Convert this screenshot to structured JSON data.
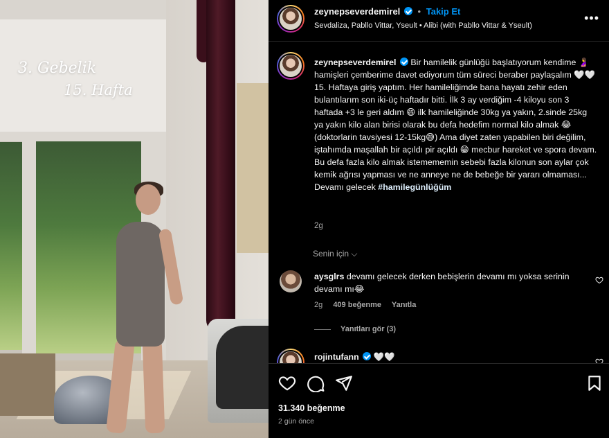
{
  "photo": {
    "overlay_line1": "3. Gebelik",
    "overlay_line2": "15. Hafta"
  },
  "header": {
    "username": "zeynepseverdemirel",
    "separator": "•",
    "follow_label": "Takip Et",
    "audio": "Sevdaliza, Pabllo Vittar, Yseult • Alibi (with Pabllo Vittar & Yseult)",
    "more_icon": "more-horizontal-icon"
  },
  "caption": {
    "username": "zeynepseverdemirel",
    "text": "Bir hamilelik günlüğü başlatıyorum kendime 🤰 hamişleri çemberime davet ediyorum tüm süreci beraber paylaşalım 🤍🤍 15. Haftaya giriş yaptım. Her hamileliğimde bana hayatı zehir eden bulantılarım son iki-üç haftadır bitti. İlk 3 ay verdiğim -4 kiloyu son 3 haftada +3 le geri aldım 😄 ilk hamileliğinde 30kg ya yakın, 2.sinde 25kg ya yakın kilo alan birisi olarak bu defa hedefim normal kilo almak 😂 (doktorlarin tavsiyesi 12-15kg😅) Ama diyet zaten yapabilen biri değilim, iştahımda maşallah bir açıldı pir açıldı 😁 mecbur hareket ve spora devam. Bu defa fazla kilo almak istemememin sebebi fazla kilonun son aylar çok kemik ağrısı yapması ve ne anneye ne de bebeğe bir yararı olmaması... Devamı gelecek",
    "hashtag": "#hamilegünlüğüm",
    "time": "2g"
  },
  "filter_label": "Senin için ⌵",
  "comments": [
    {
      "username": "aysglrs",
      "text": "devamı gelecek derken bebişlerin devamı mı yoksa serinin devamı mı😂",
      "time": "2g",
      "likes": "409 beğenme",
      "reply_label": "Yanıtla",
      "view_replies": "Yanıtları gör (3)"
    },
    {
      "username": "rojintufann",
      "text": "🤍🤍"
    }
  ],
  "actions": {
    "likes": "31.340 beğenme",
    "date": "2 gün önce"
  },
  "colors": {
    "accent": "#0095f6",
    "background": "#000000",
    "muted": "#a8a8a8"
  }
}
